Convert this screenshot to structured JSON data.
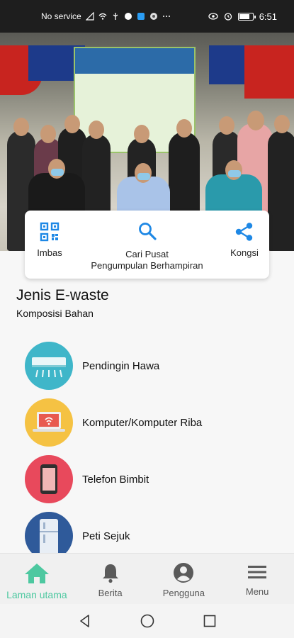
{
  "status_bar": {
    "carrier": "No service",
    "time": "6:51"
  },
  "hero": {
    "carousel_count": 3,
    "carousel_active": 1
  },
  "actions": {
    "scan_label": "Imbas",
    "search_label_line1": "Cari Pusat",
    "search_label_line2": "Pengumpulan Berhampiran",
    "share_label": "Kongsi",
    "accent": "#1e88e5"
  },
  "section": {
    "title": "Jenis E-waste",
    "subtitle": "Komposisi Bahan"
  },
  "ewaste_items": [
    {
      "label": "Pendingin Hawa",
      "icon": "air-conditioner-icon",
      "color": "#3fb6c9"
    },
    {
      "label": "Komputer/Komputer Riba",
      "icon": "laptop-icon",
      "color": "#f5c243"
    },
    {
      "label": "Telefon Bimbit",
      "icon": "mobile-phone-icon",
      "color": "#e8495c"
    },
    {
      "label": "Peti Sejuk",
      "icon": "refrigerator-icon",
      "color": "#2f5a9a"
    }
  ],
  "bottom_nav": {
    "items": [
      {
        "label": "Laman utama",
        "icon": "home-icon",
        "active": true
      },
      {
        "label": "Berita",
        "icon": "bell-icon",
        "active": false
      },
      {
        "label": "Pengguna",
        "icon": "user-icon",
        "active": false
      },
      {
        "label": "Menu",
        "icon": "menu-icon",
        "active": false
      }
    ],
    "active_color": "#4dc8a0",
    "inactive_color": "#555555"
  }
}
